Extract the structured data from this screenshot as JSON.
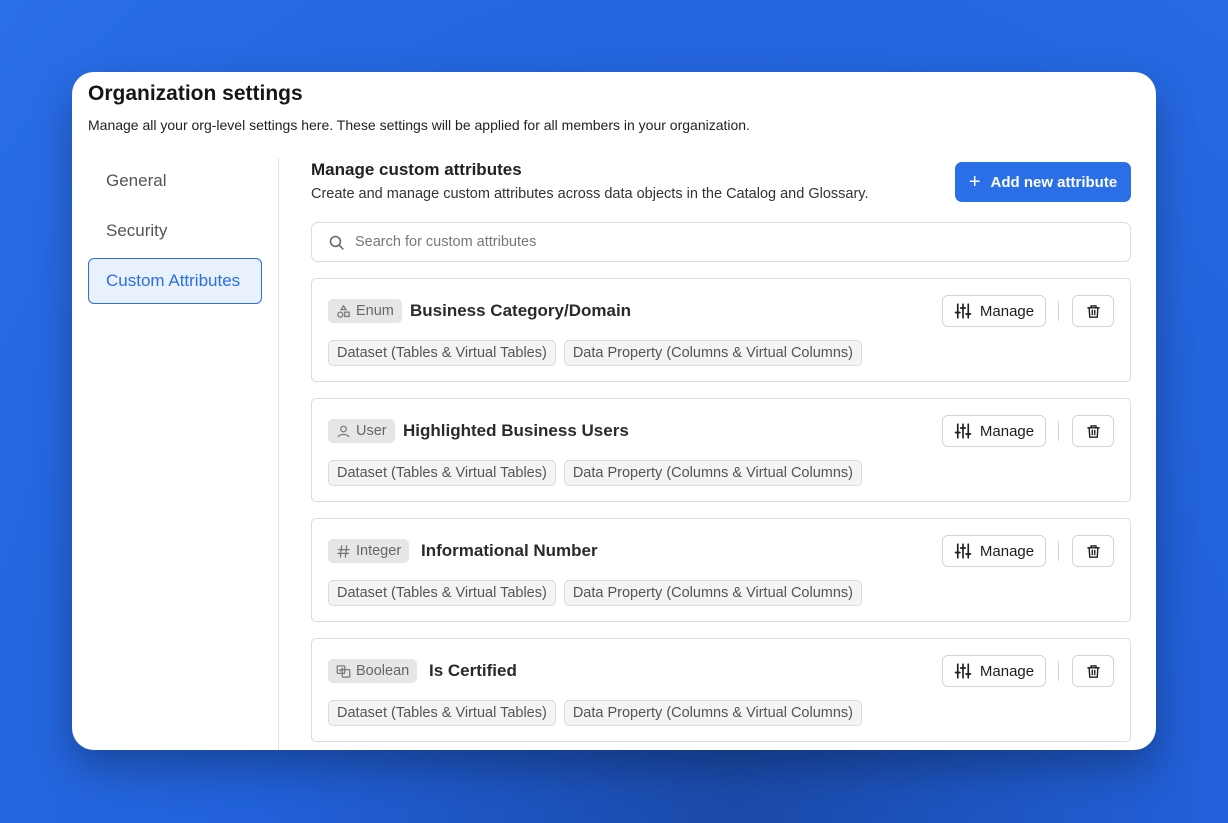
{
  "header": {
    "title": "Organization settings",
    "subtitle": "Manage all your org-level settings here. These settings will be applied for all members in your organization."
  },
  "sidebar": {
    "items": [
      {
        "label": "General",
        "active": false
      },
      {
        "label": "Security",
        "active": false
      },
      {
        "label": "Custom Attributes",
        "active": true
      }
    ]
  },
  "main": {
    "title": "Manage custom attributes",
    "subtitle": "Create and manage custom attributes across data objects in the Catalog and Glossary.",
    "add_button_label": "Add new attribute",
    "search_placeholder": "Search for custom attributes",
    "manage_label": "Manage",
    "attributes": [
      {
        "type": "Enum",
        "type_icon": "shapes-icon",
        "name": "Business Category/Domain",
        "tags": [
          "Dataset (Tables & Virtual Tables)",
          "Data Property (Columns & Virtual Columns)"
        ]
      },
      {
        "type": "User",
        "type_icon": "user-icon",
        "name": "Highlighted Business Users",
        "tags": [
          "Dataset (Tables & Virtual Tables)",
          "Data Property (Columns & Virtual Columns)"
        ]
      },
      {
        "type": "Integer",
        "type_icon": "hash-icon",
        "name": "Informational Number",
        "tags": [
          "Dataset (Tables & Virtual Tables)",
          "Data Property (Columns & Virtual Columns)"
        ]
      },
      {
        "type": "Boolean",
        "type_icon": "boolean-icon",
        "name": "Is Certified",
        "tags": [
          "Dataset (Tables & Virtual Tables)",
          "Data Property (Columns & Virtual Columns)"
        ]
      }
    ]
  },
  "colors": {
    "accent": "#2a6ee8",
    "background": "#2160d8"
  }
}
